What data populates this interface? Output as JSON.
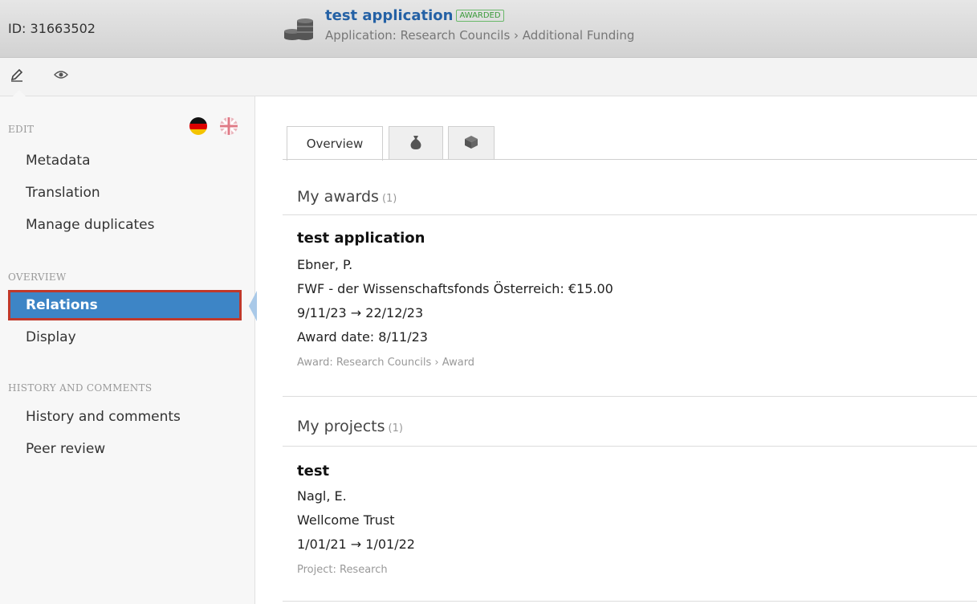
{
  "header": {
    "id_label": "ID: 31663502",
    "title": "test application",
    "status_badge": "AWARDED",
    "subtitle": "Application: Research Councils › Additional Funding",
    "icon": "coins-icon"
  },
  "toolbar": {
    "edit_icon": "pencil-icon",
    "view_icon": "eye-icon"
  },
  "sidebar": {
    "languages": [
      "german-flag-icon",
      "english-flag-icon"
    ],
    "sections": [
      {
        "label": "EDIT",
        "items": [
          "Metadata",
          "Translation",
          "Manage duplicates"
        ]
      },
      {
        "label": "OVERVIEW",
        "items": [
          "Relations",
          "Display"
        ],
        "active": "Relations"
      },
      {
        "label": "HISTORY AND COMMENTS",
        "items": [
          "History and comments",
          "Peer review"
        ]
      }
    ]
  },
  "tabs": {
    "overview": "Overview",
    "tab2_icon": "money-bag-icon",
    "tab3_icon": "box-icon"
  },
  "awards": {
    "heading": "My awards",
    "count": "(1)",
    "items": [
      {
        "title": "test application",
        "person": "Ebner, P.",
        "funder": "FWF - der Wissenschaftsfonds Österreich: €15.00",
        "period": "9/11/23 → 22/12/23",
        "award_date": "Award date: 8/11/23",
        "type": "Award: Research Councils › Award"
      }
    ]
  },
  "projects": {
    "heading": "My projects",
    "count": "(1)",
    "items": [
      {
        "title": "test",
        "person": "Nagl, E.",
        "funder": "Wellcome Trust",
        "period": "1/01/21 → 1/01/22",
        "type": "Project: Research"
      }
    ]
  },
  "colors": {
    "accent": "#3d85c6",
    "title_link": "#2461a5",
    "badge": "#3a9a3a",
    "highlight_border": "#c0392b"
  }
}
